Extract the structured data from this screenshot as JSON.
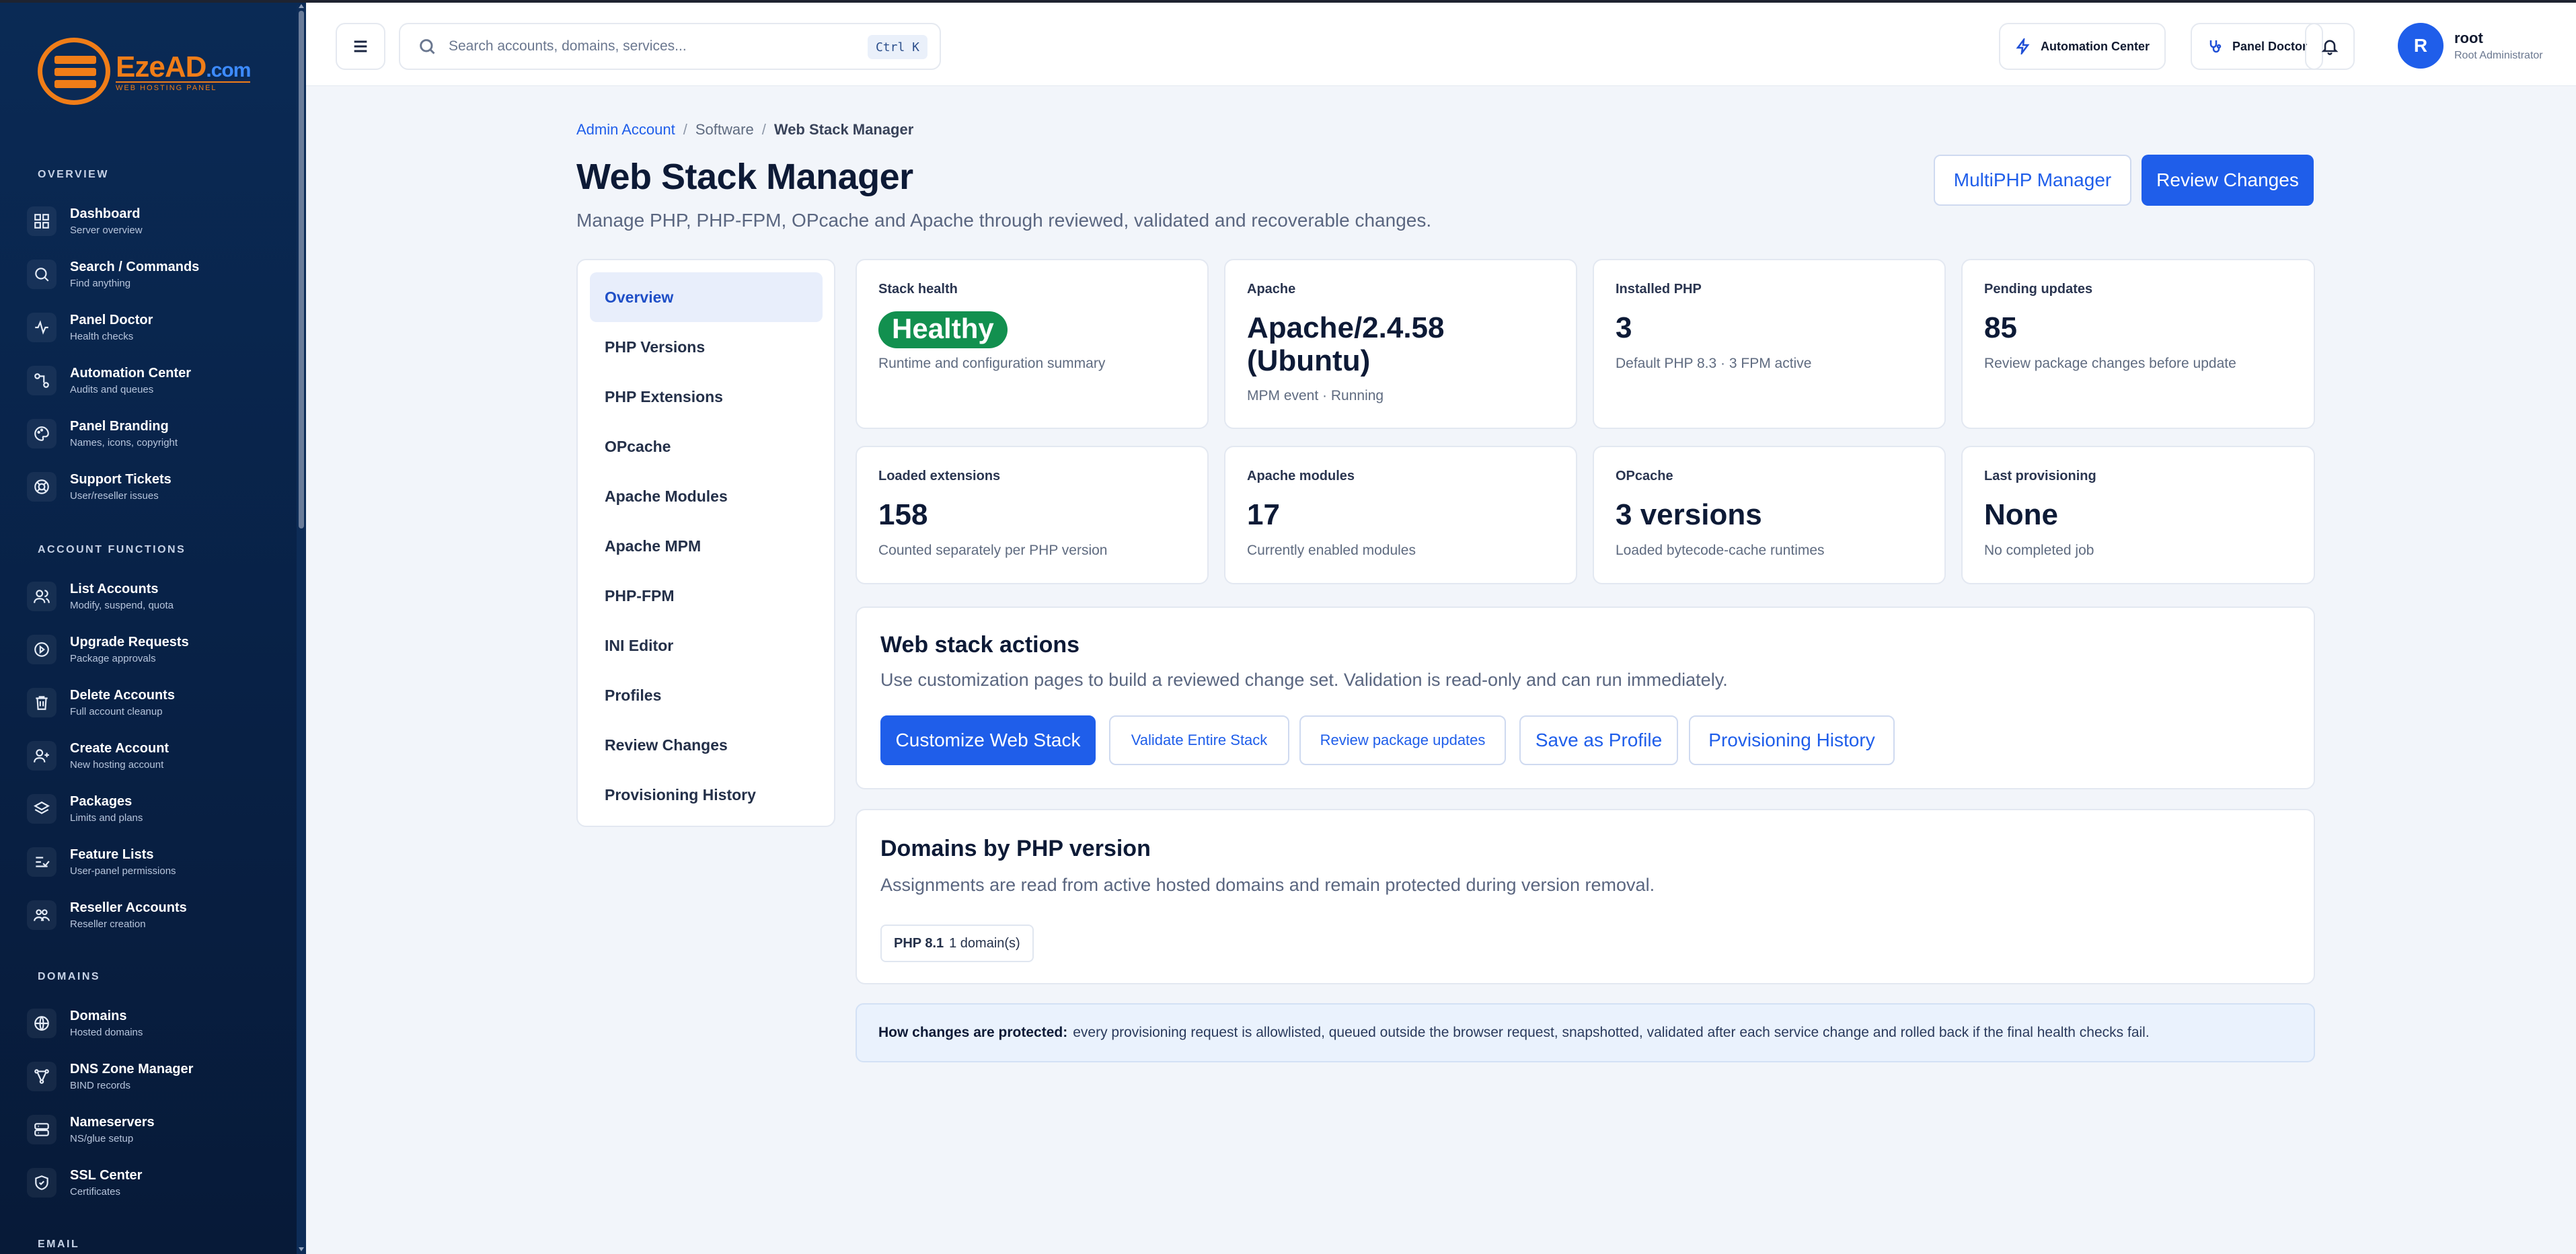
{
  "brand": {
    "name": "EzeAD",
    "suffix": ".com",
    "tagline": "WEB HOSTING PANEL"
  },
  "sidebar": {
    "sections": [
      {
        "title": "OVERVIEW"
      },
      {
        "title": "ACCOUNT FUNCTIONS"
      },
      {
        "title": "DOMAINS"
      },
      {
        "title": "EMAIL"
      }
    ],
    "items": [
      {
        "label": "Dashboard",
        "sub": "Server overview",
        "icon": "grid-icon"
      },
      {
        "label": "Search / Commands",
        "sub": "Find anything",
        "icon": "search-icon"
      },
      {
        "label": "Panel Doctor",
        "sub": "Health checks",
        "icon": "pulse-icon"
      },
      {
        "label": "Automation Center",
        "sub": "Audits and queues",
        "icon": "workflow-icon"
      },
      {
        "label": "Panel Branding",
        "sub": "Names, icons, copyright",
        "icon": "palette-icon"
      },
      {
        "label": "Support Tickets",
        "sub": "User/reseller issues",
        "icon": "lifebuoy-icon"
      },
      {
        "label": "List Accounts",
        "sub": "Modify, suspend, quota",
        "icon": "users-icon"
      },
      {
        "label": "Upgrade Requests",
        "sub": "Package approvals",
        "icon": "upgrade-icon"
      },
      {
        "label": "Delete Accounts",
        "sub": "Full account cleanup",
        "icon": "trash-icon"
      },
      {
        "label": "Create Account",
        "sub": "New hosting account",
        "icon": "user-plus-icon"
      },
      {
        "label": "Packages",
        "sub": "Limits and plans",
        "icon": "layers-icon"
      },
      {
        "label": "Feature Lists",
        "sub": "User-panel permissions",
        "icon": "list-check-icon"
      },
      {
        "label": "Reseller Accounts",
        "sub": "Reseller creation",
        "icon": "users-group-icon"
      },
      {
        "label": "Domains",
        "sub": "Hosted domains",
        "icon": "globe-icon"
      },
      {
        "label": "DNS Zone Manager",
        "sub": "BIND records",
        "icon": "network-icon"
      },
      {
        "label": "Nameservers",
        "sub": "NS/glue setup",
        "icon": "server-icon"
      },
      {
        "label": "SSL Center",
        "sub": "Certificates",
        "icon": "shield-icon"
      }
    ]
  },
  "header": {
    "search_placeholder": "Search accounts, domains, services...",
    "search_shortcut": "Ctrl K",
    "automation_label": "Automation Center",
    "doctor_label": "Panel Doctor",
    "avatar_initial": "R",
    "user_name": "root",
    "user_role": "Root Administrator"
  },
  "breadcrumb": {
    "root": "Admin Account",
    "section": "Software",
    "current": "Web Stack Manager"
  },
  "page": {
    "title": "Web Stack Manager",
    "subtitle": "Manage PHP, PHP-FPM, OPcache and Apache through reviewed, validated and recoverable changes.",
    "multiphp_label": "MultiPHP Manager",
    "review_label": "Review Changes"
  },
  "subnav": [
    "Overview",
    "PHP Versions",
    "PHP Extensions",
    "OPcache",
    "Apache Modules",
    "Apache MPM",
    "PHP-FPM",
    "INI Editor",
    "Profiles",
    "Review Changes",
    "Provisioning History"
  ],
  "stats": [
    {
      "label": "Stack health",
      "value": "Healthy",
      "desc": "Runtime and configuration summary"
    },
    {
      "label": "Apache",
      "value": "Apache/2.4.58 (Ubuntu)",
      "desc": "MPM event · Running"
    },
    {
      "label": "Installed PHP",
      "value": "3",
      "desc": "Default PHP 8.3 · 3 FPM active"
    },
    {
      "label": "Pending updates",
      "value": "85",
      "desc": "Review package changes before update"
    },
    {
      "label": "Loaded extensions",
      "value": "158",
      "desc": "Counted separately per PHP version"
    },
    {
      "label": "Apache modules",
      "value": "17",
      "desc": "Currently enabled modules"
    },
    {
      "label": "OPcache",
      "value": "3 versions",
      "desc": "Loaded bytecode-cache runtimes"
    },
    {
      "label": "Last provisioning",
      "value": "None",
      "desc": "No completed job"
    }
  ],
  "actions": {
    "title": "Web stack actions",
    "subtitle": "Use customization pages to build a reviewed change set. Validation is read-only and can run immediately.",
    "buttons": [
      "Customize Web Stack",
      "Validate Entire Stack",
      "Review package updates",
      "Save as Profile",
      "Provisioning History"
    ]
  },
  "domains": {
    "title": "Domains by PHP version",
    "subtitle": "Assignments are read from active hosted domains and remain protected during version removal.",
    "chip_version": "PHP 8.1",
    "chip_count": "1 domain(s)"
  },
  "note": {
    "strong": "How changes are protected:",
    "text": "every provisioning request is allowlisted, queued outside the browser request, snapshotted, validated after each service change and rolled back if the final health checks fail."
  },
  "colors": {
    "accent": "#1f5eea",
    "success": "#12904f",
    "sidebar": "#0a2a55",
    "brand_orange": "#f07d18"
  }
}
